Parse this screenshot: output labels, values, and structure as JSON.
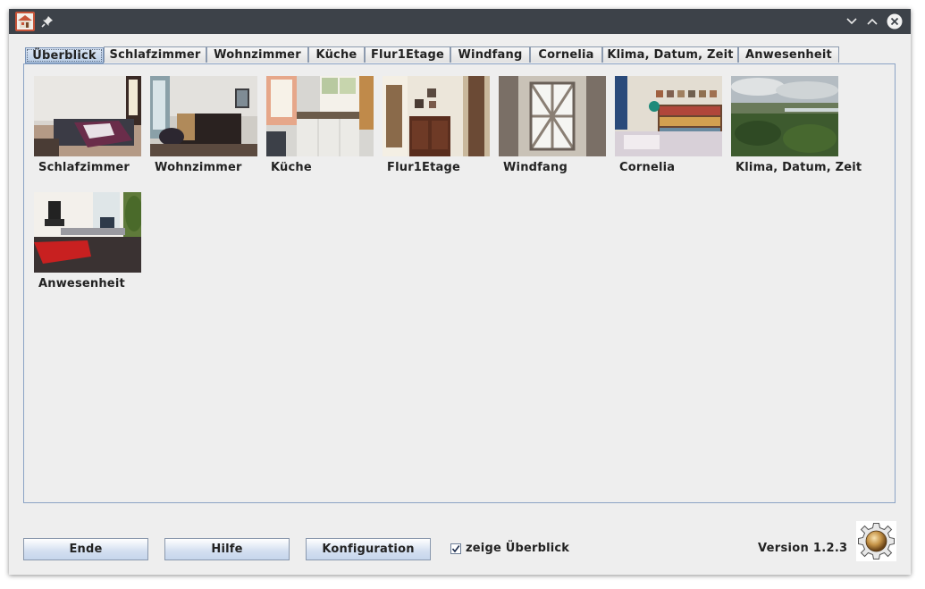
{
  "window": {
    "title": ""
  },
  "tabs": [
    {
      "label": "Überblick",
      "active": true
    },
    {
      "label": "Schlafzimmer"
    },
    {
      "label": "Wohnzimmer"
    },
    {
      "label": "Küche"
    },
    {
      "label": "Flur1Etage"
    },
    {
      "label": "Windfang"
    },
    {
      "label": "Cornelia"
    },
    {
      "label": "Klima, Datum, Zeit"
    },
    {
      "label": "Anwesenheit"
    }
  ],
  "tiles": [
    {
      "label": "Schlafzimmer",
      "icon": "bedroom-photo"
    },
    {
      "label": "Wohnzimmer",
      "icon": "living-room-photo"
    },
    {
      "label": "Küche",
      "icon": "kitchen-photo"
    },
    {
      "label": "Flur1Etage",
      "icon": "hallway-photo"
    },
    {
      "label": "Windfang",
      "icon": "front-door-photo"
    },
    {
      "label": "Cornelia",
      "icon": "study-photo"
    },
    {
      "label": "Klima, Datum, Zeit",
      "icon": "landscape-photo"
    },
    {
      "label": "Anwesenheit",
      "icon": "office-photo"
    }
  ],
  "buttons": {
    "exit": "Ende",
    "help": "Hilfe",
    "config": "Konfiguration"
  },
  "show_overview": {
    "label": "zeige Überblick",
    "checked": true
  },
  "version": "Version 1.2.3",
  "colors": {
    "titlebar": "#3d4249",
    "accent": "#b8cce6",
    "panel_border": "#8ba3c5"
  }
}
